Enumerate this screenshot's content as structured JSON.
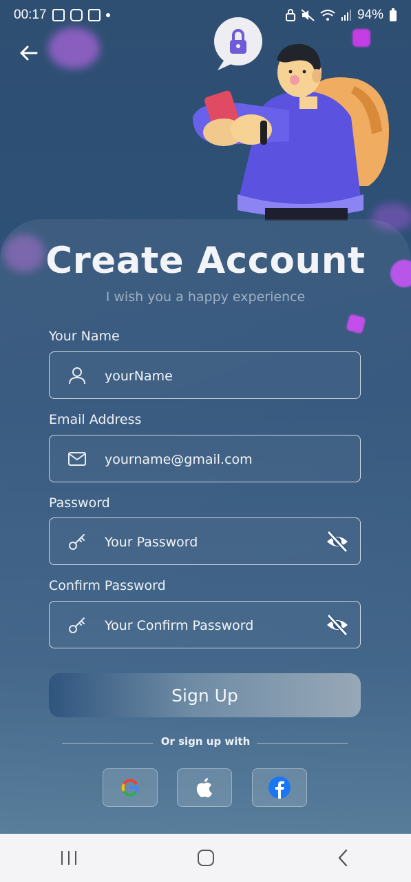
{
  "status_bar": {
    "time": "00:17",
    "battery": "94%"
  },
  "header": {
    "title": "Create Account",
    "subtitle": "I wish you a happy experience"
  },
  "form": {
    "name_label": "Your Name",
    "name_value": "yourName",
    "email_label": "Email Address",
    "email_value": "yourname@gmail.com",
    "password_label": "Password",
    "password_placeholder": "Your Password",
    "confirm_label": "Confirm Password",
    "confirm_placeholder": "Your Confirm Password"
  },
  "actions": {
    "signup_label": "Sign Up",
    "divider_text": "Or sign up with"
  },
  "social": [
    "google-icon",
    "apple-icon",
    "facebook-icon"
  ],
  "colors": {
    "background": "#2c5078",
    "accent_purple": "#b44ae8",
    "google_blue": "#4285F4",
    "google_red": "#EA4335",
    "google_yellow": "#FBBC05",
    "google_green": "#34A853",
    "facebook_blue": "#1877F2"
  }
}
